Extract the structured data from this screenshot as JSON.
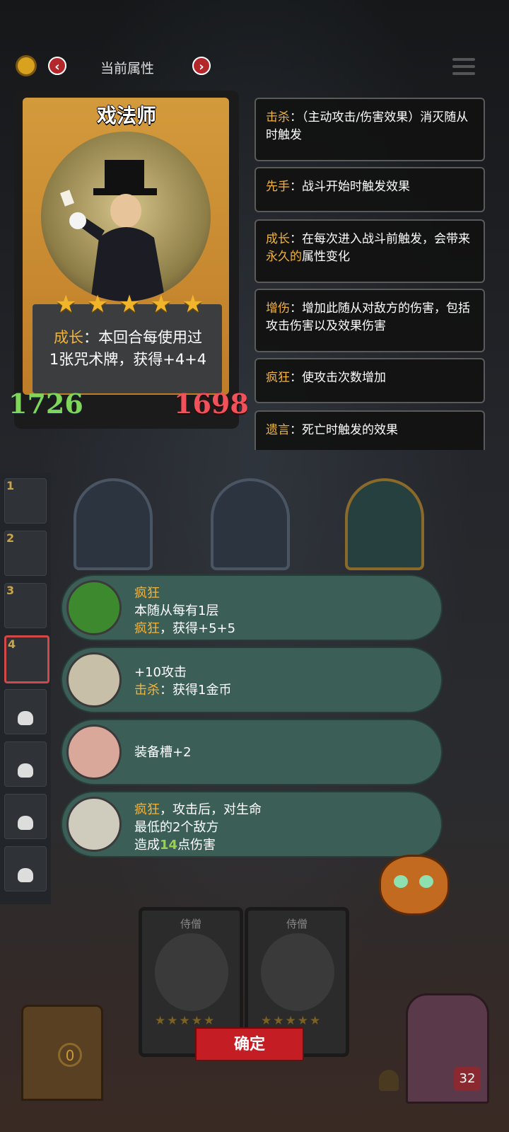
{
  "topbar": {
    "coin_value": "",
    "tab_title": "当前属性",
    "prev_symbol": "‹",
    "next_symbol": "›"
  },
  "hero": {
    "name": "戏法师",
    "stars": 5,
    "ability_keyword": "成长",
    "ability_text_1": "：本回合每使用过",
    "ability_text_2": "1张咒术牌，获得+4+4",
    "attack": "1726",
    "health": "1698"
  },
  "glossary": [
    {
      "keyword": "击杀",
      "text": "：（主动攻击/伤害效果）消灭随从时触发"
    },
    {
      "keyword": "先手",
      "text": "：战斗开始时触发效果"
    },
    {
      "keyword": "成长",
      "text_a": "：在每次进入战斗前触发，会带来",
      "highlight": "永久的",
      "text_b": "属性变化"
    },
    {
      "keyword": "增伤",
      "text": "：增加此随从对敌方的伤害，包括攻击伤害以及效果伤害"
    },
    {
      "keyword": "疯狂",
      "text": "：使攻击次数增加"
    },
    {
      "keyword": "遗言",
      "text": "：死亡时触发的效果"
    }
  ],
  "equipment": [
    {
      "icon": "skull-icon",
      "title": "疯狂",
      "line2": "本随从每有1层",
      "kw3": "疯狂",
      "line3": "，获得+5+5"
    },
    {
      "icon": "glove-icon",
      "line1": "+10攻击",
      "kw2": "击杀",
      "line2": "：获得1金币"
    },
    {
      "icon": "pig-icon",
      "line1": "装备槽+2"
    },
    {
      "icon": "claw-icon",
      "kw1": "疯狂",
      "line1": "，攻击后，对生命",
      "line2": "最低的2个敌方",
      "line3a": "造成",
      "line3num": "14",
      "line3b": "点伤害"
    }
  ],
  "sidebar": {
    "items": [
      {
        "num": "1"
      },
      {
        "num": "2"
      },
      {
        "num": "3"
      },
      {
        "num": "4"
      },
      {
        "num": ""
      },
      {
        "num": ""
      },
      {
        "num": ""
      },
      {
        "num": ""
      }
    ]
  },
  "hand": {
    "cards": [
      {
        "name": "侍僧"
      },
      {
        "name": "侍僧"
      }
    ]
  },
  "bottom": {
    "confirm_label": "确定",
    "chest_count": "0",
    "life": "32"
  },
  "colors": {
    "keyword": "#f2b33d",
    "attack": "#7fd65a",
    "health": "#f0515a",
    "equip_bg": "#3b5f57",
    "confirm": "#c41d24"
  }
}
